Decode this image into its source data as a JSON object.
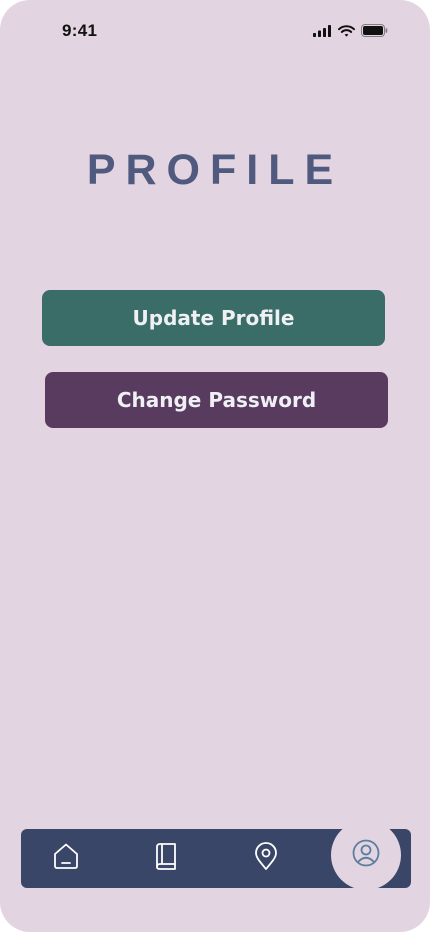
{
  "status_bar": {
    "time": "9:41"
  },
  "header": {
    "title": "PROFILE"
  },
  "actions": {
    "update_profile_label": "Update Profile",
    "change_password_label": "Change Password"
  },
  "tab_bar": {
    "items": [
      {
        "icon": "home-icon",
        "active": false
      },
      {
        "icon": "book-icon",
        "active": false
      },
      {
        "icon": "location-icon",
        "active": false
      },
      {
        "icon": "user-icon",
        "active": true
      }
    ]
  },
  "colors": {
    "background": "#e3d4e1",
    "title": "#4f5a7e",
    "update_button": "#3a6c68",
    "password_button": "#5a3b60",
    "tab_bar": "#394667",
    "active_icon": "#5b7f9c"
  }
}
